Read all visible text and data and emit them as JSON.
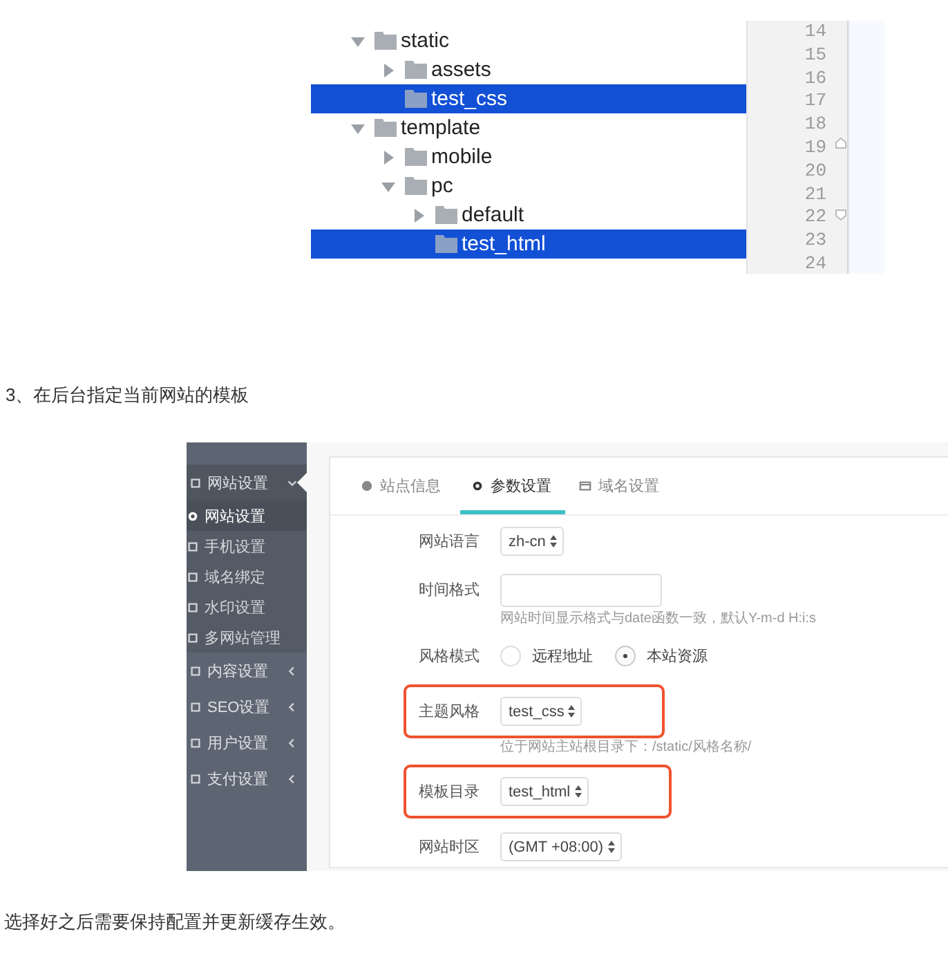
{
  "file_tree": {
    "items": [
      {
        "label": "static",
        "expanded": true,
        "selected": false,
        "children": [
          {
            "label": "assets",
            "expanded": false,
            "selected": false
          },
          {
            "label": "test_css",
            "selected": true
          }
        ]
      },
      {
        "label": "template",
        "expanded": true,
        "selected": false,
        "children": [
          {
            "label": "mobile",
            "expanded": false,
            "selected": false
          },
          {
            "label": "pc",
            "expanded": true,
            "selected": false,
            "children": [
              {
                "label": "default",
                "expanded": false,
                "selected": false
              },
              {
                "label": "test_html",
                "selected": true
              }
            ]
          }
        ]
      }
    ]
  },
  "line_numbers": [
    "14",
    "15",
    "16",
    "17",
    "18",
    "19",
    "20",
    "21",
    "22",
    "23",
    "24"
  ],
  "step_text": "3、在后台指定当前网站的模板",
  "admin": {
    "sidebar": {
      "items": [
        {
          "label": "网站设置",
          "expanded": true,
          "children": [
            {
              "label": "网站设置",
              "selected": true
            },
            {
              "label": "手机设置",
              "selected": false
            },
            {
              "label": "域名绑定",
              "selected": false
            },
            {
              "label": "水印设置",
              "selected": false
            },
            {
              "label": "多网站管理",
              "selected": false
            }
          ]
        },
        {
          "label": "内容设置",
          "expanded": false
        },
        {
          "label": "SEO设置",
          "expanded": false
        },
        {
          "label": "用户设置",
          "expanded": false
        },
        {
          "label": "支付设置",
          "expanded": false
        }
      ]
    },
    "tabs": [
      {
        "label": "站点信息",
        "selected": false
      },
      {
        "label": "参数设置",
        "selected": true
      },
      {
        "label": "域名设置",
        "selected": false
      }
    ],
    "fields": [
      {
        "kind": "select",
        "label": "网站语言",
        "value": "zh-cn",
        "highlighted": false
      },
      {
        "kind": "text",
        "label": "时间格式",
        "hint": "网站时间显示格式与date函数一致，默认Y-m-d H:i:s",
        "highlighted": false
      },
      {
        "kind": "radio",
        "label": "风格模式",
        "options": [
          {
            "label": "远程地址",
            "selected": false
          },
          {
            "label": "本站资源",
            "selected": true
          }
        ],
        "highlighted": false
      },
      {
        "kind": "select",
        "label": "主题风格",
        "value": "test_css",
        "hint": "位于网站主站根目录下：/static/风格名称/",
        "highlighted": true
      },
      {
        "kind": "select",
        "label": "模板目录",
        "value": "test_html",
        "highlighted": true
      },
      {
        "kind": "select",
        "label": "网站时区",
        "value": "(GMT +08:00)",
        "highlighted": false
      }
    ]
  },
  "closing_text": "选择好之后需要保持配置并更新缓存生效。"
}
